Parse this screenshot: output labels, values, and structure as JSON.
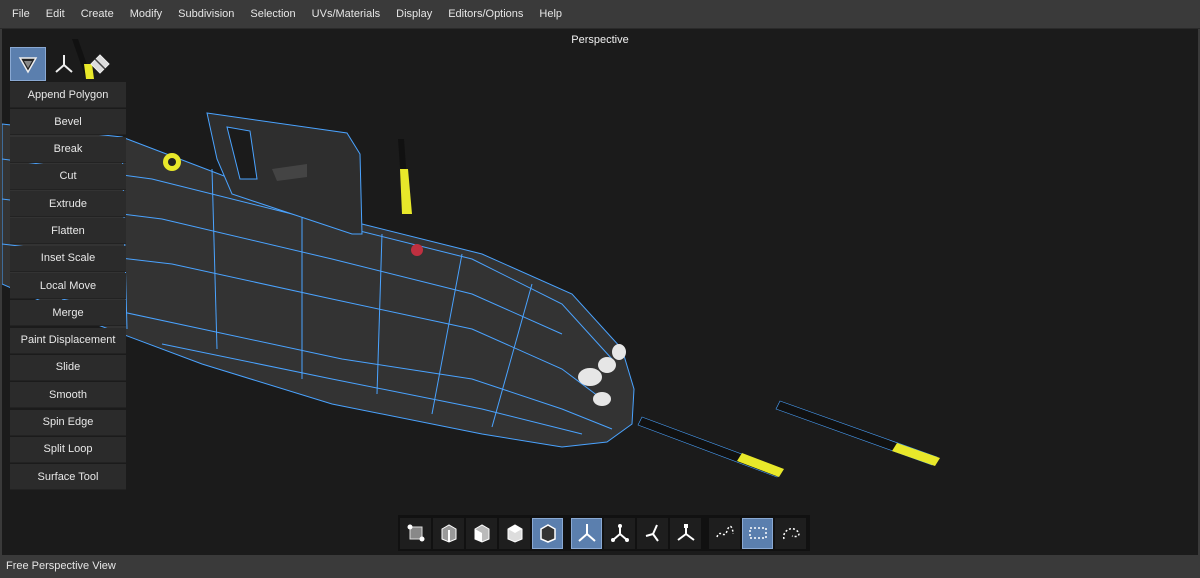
{
  "menu": {
    "items": [
      "File",
      "Edit",
      "Create",
      "Modify",
      "Subdivision",
      "Selection",
      "UVs/Materials",
      "Display",
      "Editors/Options",
      "Help"
    ]
  },
  "viewport": {
    "title": "Perspective"
  },
  "tool_panel": {
    "modes": [
      {
        "icon": "polygon-mode-icon",
        "active": true
      },
      {
        "icon": "transform-axes-icon",
        "active": false
      },
      {
        "icon": "uv-diamond-icon",
        "active": false
      }
    ],
    "tools": [
      "Append Polygon",
      "Bevel",
      "Break",
      "Cut",
      "Extrude",
      "Flatten",
      "Inset Scale",
      "Local Move",
      "Merge",
      "Paint Displacement",
      "Slide",
      "Smooth",
      "Spin Edge",
      "Split Loop",
      "Surface Tool"
    ]
  },
  "bottom_toolbar": {
    "buttons": [
      {
        "icon": "vertex-select-icon",
        "active": false
      },
      {
        "icon": "edge-select-icon",
        "active": false
      },
      {
        "icon": "face-select-icon",
        "active": false
      },
      {
        "icon": "object-select-icon",
        "active": false
      },
      {
        "icon": "mesh-select-icon",
        "active": true
      },
      {
        "icon": "axis-move-icon",
        "active": true
      },
      {
        "icon": "axis-rotate-icon",
        "active": false
      },
      {
        "icon": "axis-scale-icon",
        "active": false
      },
      {
        "icon": "axis-local-icon",
        "active": false
      },
      {
        "icon": "lasso-select-icon",
        "active": false
      },
      {
        "icon": "rect-select-icon",
        "active": true
      },
      {
        "icon": "paint-select-icon",
        "active": false
      }
    ]
  },
  "colors": {
    "accent": "#5b7fae",
    "wireframe": "#4aa3ff",
    "hull": "#333333",
    "missile_tip": "#e8e82a"
  },
  "status": {
    "text": "Free Perspective View"
  }
}
